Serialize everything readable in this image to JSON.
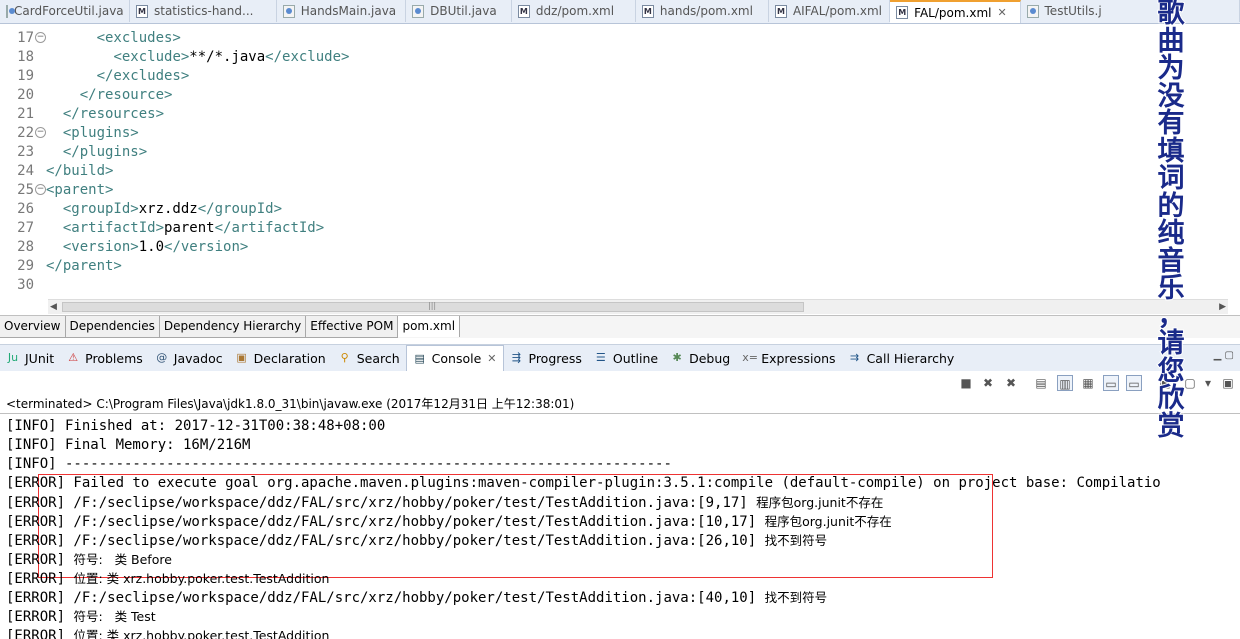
{
  "editor_tabs": [
    {
      "label": "CardForceUtil.java",
      "icon": "java-file-icon",
      "active": false
    },
    {
      "label": "statistics-hand...",
      "icon": "maven-file-icon",
      "active": false
    },
    {
      "label": "HandsMain.java",
      "icon": "java-file-icon",
      "active": false
    },
    {
      "label": "DBUtil.java",
      "icon": "java-file-icon",
      "active": false
    },
    {
      "label": "ddz/pom.xml",
      "icon": "maven-file-icon",
      "active": false
    },
    {
      "label": "hands/pom.xml",
      "icon": "maven-file-icon",
      "active": false
    },
    {
      "label": "AIFAL/pom.xml",
      "icon": "maven-file-icon",
      "active": false
    },
    {
      "label": "FAL/pom.xml",
      "icon": "maven-file-icon",
      "active": true
    },
    {
      "label": "TestUtils.j",
      "icon": "java-file-icon",
      "active": false
    }
  ],
  "code_lines": [
    {
      "num": "17",
      "fold": true,
      "text": "      <excludes>"
    },
    {
      "num": "18",
      "fold": false,
      "text": "        <exclude>**/*.java</exclude>"
    },
    {
      "num": "19",
      "fold": false,
      "text": "      </excludes>"
    },
    {
      "num": "20",
      "fold": false,
      "text": "    </resource>"
    },
    {
      "num": "21",
      "fold": false,
      "text": "  </resources>"
    },
    {
      "num": "22",
      "fold": true,
      "text": "  <plugins>"
    },
    {
      "num": "23",
      "fold": false,
      "text": "  </plugins>"
    },
    {
      "num": "24",
      "fold": false,
      "text": "</build>"
    },
    {
      "num": "25",
      "fold": true,
      "text": "<parent>"
    },
    {
      "num": "26",
      "fold": false,
      "text": "  <groupId>xrz.ddz</groupId>"
    },
    {
      "num": "27",
      "fold": false,
      "text": "  <artifactId>parent</artifactId>"
    },
    {
      "num": "28",
      "fold": false,
      "text": "  <version>1.0</version>"
    },
    {
      "num": "29",
      "fold": false,
      "text": "</parent>"
    },
    {
      "num": "30",
      "fold": false,
      "text": ""
    }
  ],
  "pom_tabs": [
    "Overview",
    "Dependencies",
    "Dependency Hierarchy",
    "Effective POM",
    "pom.xml"
  ],
  "pom_active": "pom.xml",
  "view_tabs": [
    {
      "label": "JUnit",
      "icon": "junit-icon"
    },
    {
      "label": "Problems",
      "icon": "problems-icon"
    },
    {
      "label": "Javadoc",
      "icon": "javadoc-icon"
    },
    {
      "label": "Declaration",
      "icon": "declaration-icon"
    },
    {
      "label": "Search",
      "icon": "search-icon"
    },
    {
      "label": "Console",
      "icon": "console-icon",
      "active": true
    },
    {
      "label": "Progress",
      "icon": "progress-icon"
    },
    {
      "label": "Outline",
      "icon": "outline-icon"
    },
    {
      "label": "Debug",
      "icon": "debug-icon"
    },
    {
      "label": "Expressions",
      "icon": "expressions-icon"
    },
    {
      "label": "Call Hierarchy",
      "icon": "call-hierarchy-icon"
    }
  ],
  "terminated_text": "<terminated> C:\\Program Files\\Java\\jdk1.8.0_31\\bin\\javaw.exe (2017年12月31日 上午12:38:01)",
  "console_lines": [
    {
      "text": "[INFO] Finished at: 2017-12-31T00:38:48+08:00",
      "cjk": ""
    },
    {
      "text": "[INFO] Final Memory: 16M/216M",
      "cjk": ""
    },
    {
      "text": "[INFO] ------------------------------------------------------------------------",
      "cjk": ""
    },
    {
      "text": "[ERROR] Failed to execute goal org.apache.maven.plugins:maven-compiler-plugin:3.5.1:compile (default-compile) on project base: Compilatio",
      "cjk": ""
    },
    {
      "text": "[ERROR] /F:/seclipse/workspace/ddz/FAL/src/xrz/hobby/poker/test/TestAddition.java:[9,17] ",
      "cjk": "程序包org.junit不存在"
    },
    {
      "text": "[ERROR] /F:/seclipse/workspace/ddz/FAL/src/xrz/hobby/poker/test/TestAddition.java:[10,17] ",
      "cjk": "程序包org.junit不存在"
    },
    {
      "text": "[ERROR] /F:/seclipse/workspace/ddz/FAL/src/xrz/hobby/poker/test/TestAddition.java:[26,10] ",
      "cjk": "找不到符号"
    },
    {
      "text": "[ERROR] ",
      "cjk": "符号:   类 Before"
    },
    {
      "text": "[ERROR] ",
      "cjk": "位置: 类 xrz.hobby.poker.test.TestAddition"
    },
    {
      "text": "[ERROR] /F:/seclipse/workspace/ddz/FAL/src/xrz/hobby/poker/test/TestAddition.java:[40,10] ",
      "cjk": "找不到符号"
    },
    {
      "text": "[ERROR] ",
      "cjk": "符号:   类 Test"
    },
    {
      "text": "[ERROR] ",
      "cjk": "位置: 类 xrz.hobby.poker.test.TestAddition"
    }
  ],
  "overlay_text": "歌曲为没有填词的纯音乐，请您欣赏",
  "colors": {
    "tag": "#3f7f7f",
    "highlight_box": "#ee3333",
    "overlay_text": "#1a2a8a"
  }
}
